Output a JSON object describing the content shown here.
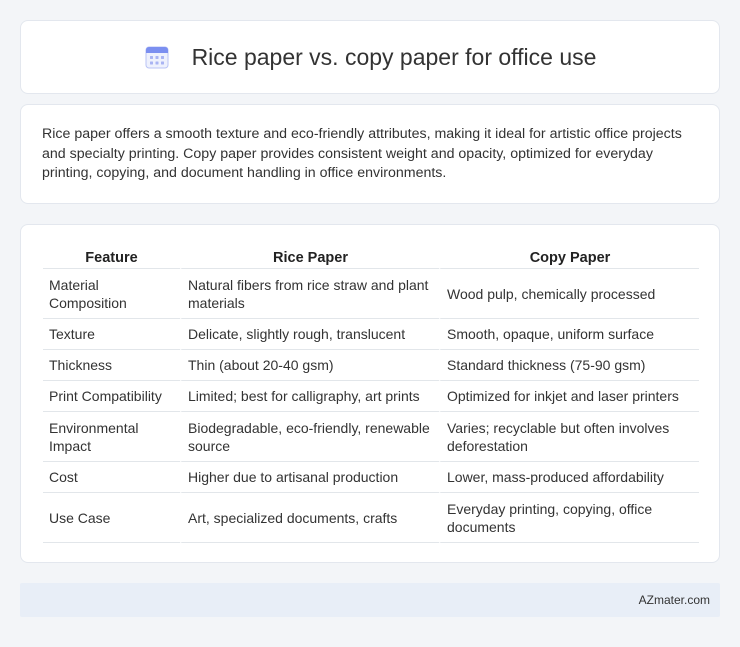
{
  "header": {
    "icon": "calendar-icon",
    "title": "Rice paper vs. copy paper for office use"
  },
  "description": "Rice paper offers a smooth texture and eco-friendly attributes, making it ideal for artistic office projects and specialty printing. Copy paper provides consistent weight and opacity, optimized for everyday printing, copying, and document handling in office environments.",
  "table": {
    "headers": [
      "Feature",
      "Rice Paper",
      "Copy Paper"
    ],
    "rows": [
      [
        "Material Composition",
        "Natural fibers from rice straw and plant materials",
        "Wood pulp, chemically processed"
      ],
      [
        "Texture",
        "Delicate, slightly rough, translucent",
        "Smooth, opaque, uniform surface"
      ],
      [
        "Thickness",
        "Thin (about 20-40 gsm)",
        "Standard thickness (75-90 gsm)"
      ],
      [
        "Print Compatibility",
        "Limited; best for calligraphy, art prints",
        "Optimized for inkjet and laser printers"
      ],
      [
        "Environmental Impact",
        "Biodegradable, eco-friendly, renewable source",
        "Varies; recyclable but often involves deforestation"
      ],
      [
        "Cost",
        "Higher due to artisanal production",
        "Lower, mass-produced affordability"
      ],
      [
        "Use Case",
        "Art, specialized documents, crafts",
        "Everyday printing, copying, office documents"
      ]
    ]
  },
  "footer": {
    "site": "AZmater.com"
  },
  "colors": {
    "background": "#f3f5f8",
    "card": "#ffffff",
    "footer_bg": "#e8eef7",
    "icon_accent": "#7b8ff0"
  }
}
